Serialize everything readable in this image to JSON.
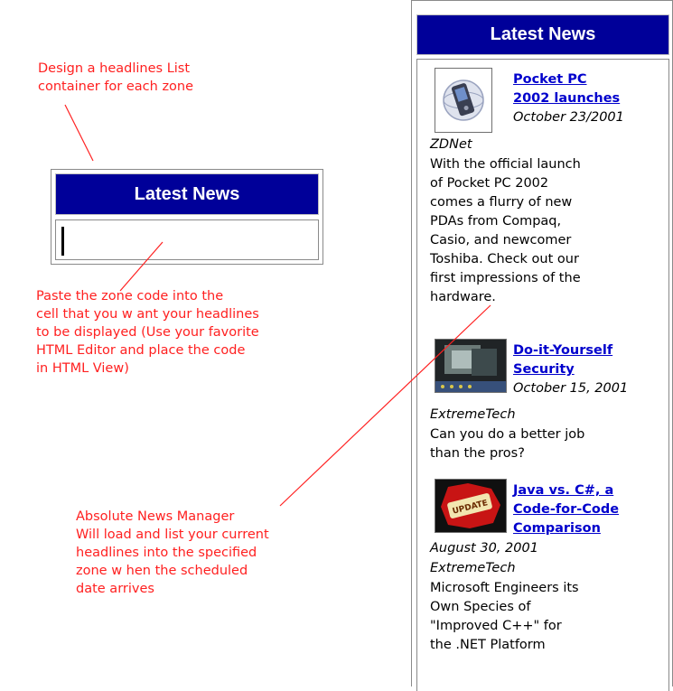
{
  "annotations": {
    "design_container": "Design a headlines List\ncontainer for each zone",
    "paste_zone_code": "Paste the zone code into the\ncell that you w ant your headlines\nto be displayed (Use your favorite\nHTML Editor and place the code\nin HTML View)",
    "manager_loads": "Absolute News Manager\nWill load and list your current\nheadlines into the specified\nzone w hen the scheduled\ndate arrives"
  },
  "small_box": {
    "header": "Latest News"
  },
  "news_panel": {
    "header": "Latest News",
    "items": [
      {
        "title": "Pocket PC\n2002 launches",
        "date": "October 23/2001",
        "source": "ZDNet",
        "summary": "With the official launch\nof Pocket PC 2002\ncomes a flurry of new\nPDAs from Compaq,\nCasio, and newcomer\nToshiba. Check out our\nfirst impressions of the\nhardware.",
        "thumb_icon": "pda-photo-icon"
      },
      {
        "title": "Do-it-Yourself\nSecurity",
        "date": "October 15, 2001",
        "source": "ExtremeTech",
        "summary": "Can you do a better job\nthan the pros?",
        "thumb_icon": "security-camera-photo-icon"
      },
      {
        "title": "Java vs. C#, a\nCode-for-Code\nComparison",
        "date": "August 30, 2001",
        "source": "ExtremeTech",
        "summary": "Microsoft Engineers its\nOwn Species of\n\"Improved C++\" for\nthe .NET Platform",
        "thumb_icon": "update-stamp-icon"
      }
    ]
  },
  "colors": {
    "annotation": "#ff2020",
    "header_bg": "#000099",
    "link": "#0000cc"
  }
}
